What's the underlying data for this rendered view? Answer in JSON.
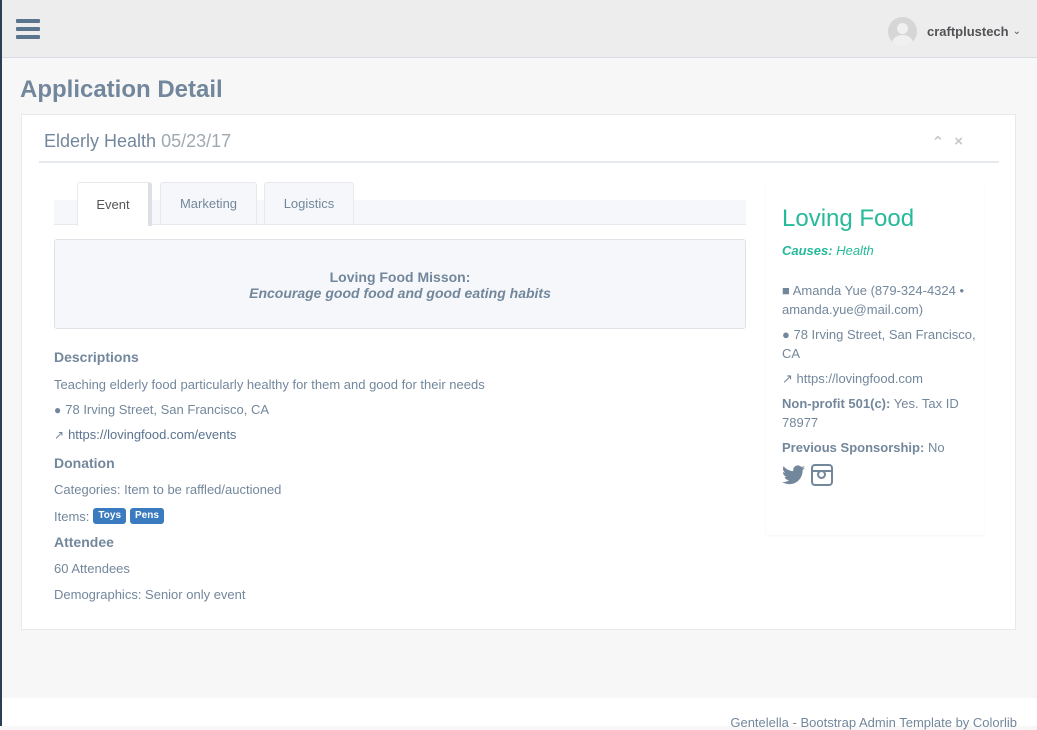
{
  "topnav": {
    "user_name": "craftplustech",
    "caret": "⌄"
  },
  "page": {
    "title": "Application Detail"
  },
  "panel": {
    "title": "Elderly Health",
    "date": "05/23/17",
    "collapse_icon": "chevron-up-icon",
    "close_icon": "close-icon"
  },
  "tabs": [
    "Event",
    "Marketing",
    "Logistics"
  ],
  "mission": {
    "label": "Loving Food Misson:",
    "text": "Encourage good food and good eating habits"
  },
  "descriptions": {
    "heading": "Descriptions",
    "text": "Teaching elderly food particularly healthy for them and good for their needs",
    "address": "78 Irving Street, San Francisco, CA",
    "url": "https://lovingfood.com/events"
  },
  "donation": {
    "heading": "Donation",
    "categories": "Categories: Item to be raffled/auctioned",
    "items_label": "Items:",
    "items": [
      "Toys",
      "Pens"
    ]
  },
  "attendee": {
    "heading": "Attendee",
    "count": "60 Attendees",
    "demographics": "Demographics: Senior only event"
  },
  "org": {
    "name": "Loving Food",
    "causes_label": "Causes:",
    "causes_value": "Health",
    "contact": "Amanda Yue (879-324-4324 • amanda.yue@mail.com)",
    "address": "78 Irving Street, San Francisco, CA",
    "url": "https://lovingfood.com",
    "nonprofit_label": "Non-profit 501(c):",
    "nonprofit_value": "Yes. Tax ID 78977",
    "sponsorship_label": "Previous Sponsorship:",
    "sponsorship_value": "No"
  },
  "footer": {
    "text": "Gentelella - Bootstrap Admin Template by Colorlib"
  },
  "colors": {
    "accent": "#26B99A",
    "badge": "#3a7abf",
    "text": "#73879C"
  }
}
